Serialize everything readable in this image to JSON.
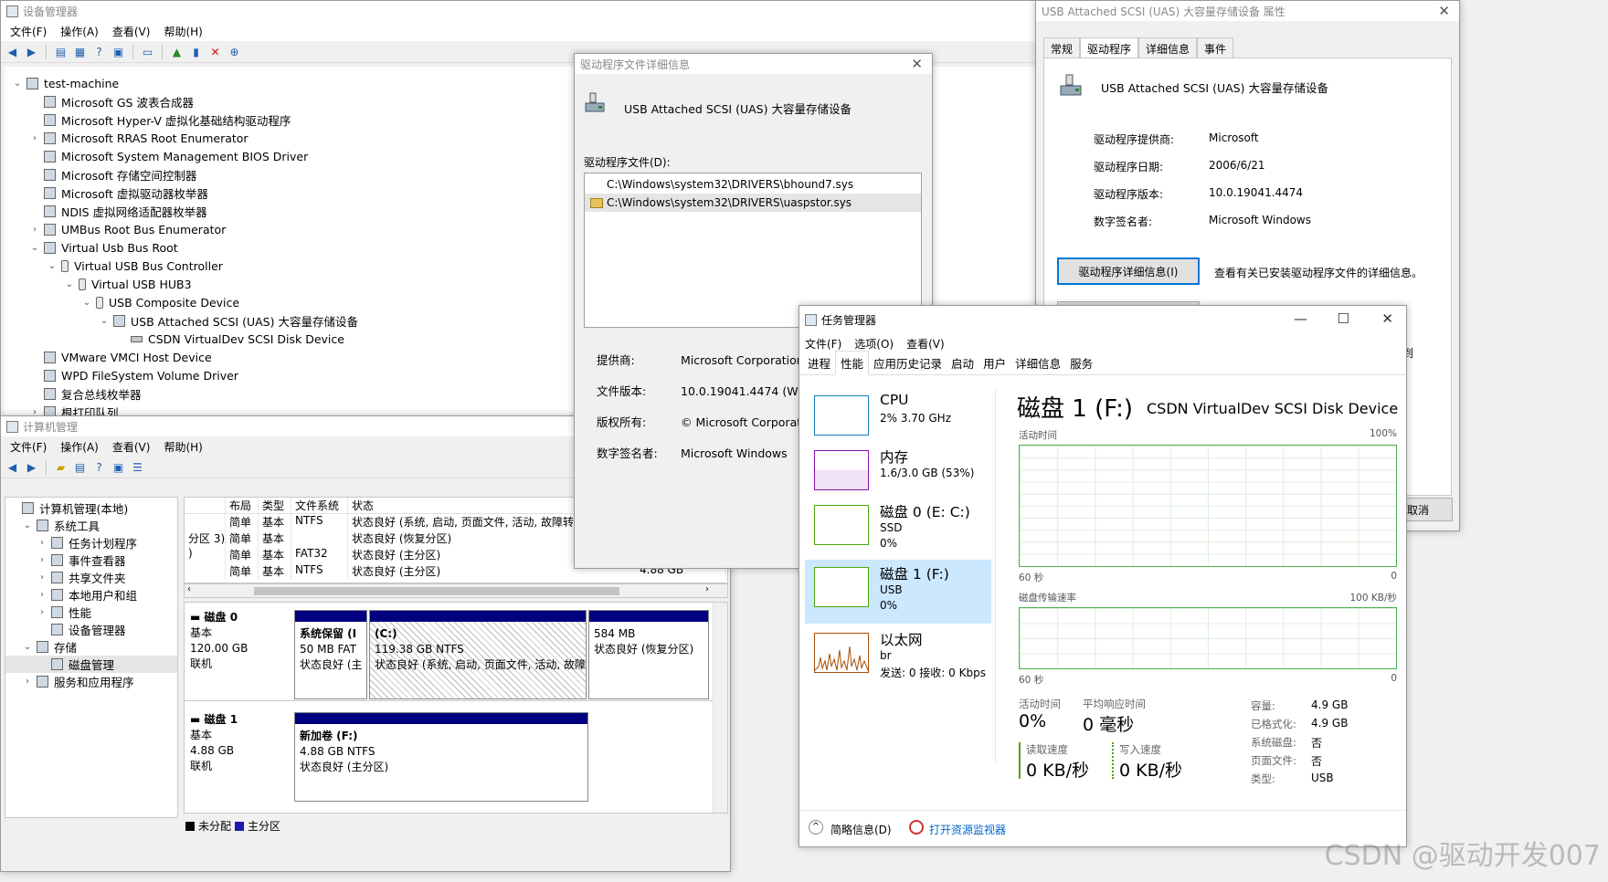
{
  "device_manager": {
    "title": "设备管理器",
    "menu": [
      "文件(F)",
      "操作(A)",
      "查看(V)",
      "帮助(H)"
    ],
    "tree": [
      {
        "label": "test-machine",
        "exp": "v",
        "level": 0
      },
      {
        "label": "Microsoft GS 波表合成器",
        "exp": "",
        "level": 1
      },
      {
        "label": "Microsoft Hyper-V 虚拟化基础结构驱动程序",
        "exp": "",
        "level": 1
      },
      {
        "label": "Microsoft RRAS Root Enumerator",
        "exp": ">",
        "level": 1
      },
      {
        "label": "Microsoft System Management BIOS Driver",
        "exp": "",
        "level": 1
      },
      {
        "label": "Microsoft 存储空间控制器",
        "exp": "",
        "level": 1
      },
      {
        "label": "Microsoft 虚拟驱动器枚举器",
        "exp": "",
        "level": 1
      },
      {
        "label": "NDIS 虚拟网络适配器枚举器",
        "exp": "",
        "level": 1
      },
      {
        "label": "UMBus Root Bus Enumerator",
        "exp": ">",
        "level": 1
      },
      {
        "label": "Virtual Usb Bus Root",
        "exp": "v",
        "level": 1
      },
      {
        "label": "Virtual USB Bus Controller",
        "exp": "v",
        "level": 2
      },
      {
        "label": "Virtual USB HUB3",
        "exp": "v",
        "level": 3
      },
      {
        "label": "USB Composite Device",
        "exp": "v",
        "level": 4
      },
      {
        "label": "USB Attached SCSI (UAS) 大容量存储设备",
        "exp": "v",
        "level": 5
      },
      {
        "label": "CSDN VirtualDev SCSI Disk Device",
        "exp": "",
        "level": 6
      },
      {
        "label": "VMware VMCI Host Device",
        "exp": "",
        "level": 1
      },
      {
        "label": "WPD FileSystem Volume Driver",
        "exp": "",
        "level": 1
      },
      {
        "label": "复合总线枚举器",
        "exp": "",
        "level": 1
      },
      {
        "label": "根打印队列",
        "exp": ">",
        "level": 1
      }
    ]
  },
  "computer_management": {
    "title": "计算机管理",
    "menu": [
      "文件(F)",
      "操作(A)",
      "查看(V)",
      "帮助(H)"
    ],
    "nav": [
      {
        "label": "计算机管理(本地)",
        "exp": "",
        "level": 0
      },
      {
        "label": "系统工具",
        "exp": "v",
        "level": 1
      },
      {
        "label": "任务计划程序",
        "exp": ">",
        "level": 2
      },
      {
        "label": "事件查看器",
        "exp": ">",
        "level": 2
      },
      {
        "label": "共享文件夹",
        "exp": ">",
        "level": 2
      },
      {
        "label": "本地用户和组",
        "exp": ">",
        "level": 2
      },
      {
        "label": "性能",
        "exp": ">",
        "level": 2
      },
      {
        "label": "设备管理器",
        "exp": "",
        "level": 2
      },
      {
        "label": "存储",
        "exp": "v",
        "level": 1
      },
      {
        "label": "磁盘管理",
        "exp": "",
        "level": 2
      },
      {
        "label": "服务和应用程序",
        "exp": ">",
        "level": 1
      }
    ],
    "columns": [
      "",
      "布局",
      "类型",
      "文件系统",
      "状态"
    ],
    "rows": [
      [
        "",
        "简单",
        "基本",
        "NTFS",
        "状态良好 (系统, 启动, 页面文件, 活动, 故障转储"
      ],
      [
        "分区 3)",
        "简单",
        "基本",
        "",
        "状态良好 (恢复分区)"
      ],
      [
        ")",
        "简单",
        "基本",
        "FAT32",
        "状态良好 (主分区)"
      ],
      [
        "",
        "简单",
        "基本",
        "NTFS",
        "状态良好 (主分区)"
      ]
    ],
    "disk0": {
      "name": "磁盘 0",
      "type": "基本",
      "size": "120.00 GB",
      "status": "联机",
      "parts": [
        {
          "name": "系统保留 (I",
          "size": "50 MB FAT",
          "status": "状态良好 (主"
        },
        {
          "name": "(C:)",
          "size": "119.38 GB NTFS",
          "status": "状态良好 (系统, 启动, 页面文件, 活动, 故障"
        },
        {
          "name": "",
          "size": "584 MB",
          "status": "状态良好 (恢复分区)"
        }
      ]
    },
    "disk1": {
      "name": "磁盘 1",
      "type": "基本",
      "size": "4.88 GB",
      "status": "联机",
      "parts": [
        {
          "name": "新加卷 (F:)",
          "size": "4.88 GB NTFS",
          "status": "状态良好 (主分区)"
        }
      ]
    },
    "legend": {
      "unallocated": "未分配",
      "primary": "主分区"
    }
  },
  "driver_details": {
    "title": "驱动程序文件详细信息",
    "device": "USB Attached SCSI (UAS) 大容量存储设备",
    "files_label": "驱动程序文件(D):",
    "files": [
      "C:\\Windows\\system32\\DRIVERS\\bhound7.sys",
      "C:\\Windows\\system32\\DRIVERS\\uaspstor.sys"
    ],
    "provider_k": "提供商:",
    "provider_v": "Microsoft Corporation",
    "version_k": "文件版本:",
    "version_v": "10.0.19041.4474 (WinB",
    "copyright_k": "版权所有:",
    "copyright_v": "© Microsoft Corporati",
    "signer_k": "数字签名者:",
    "signer_v": "Microsoft Windows"
  },
  "properties": {
    "title": "USB Attached SCSI (UAS) 大容量存储设备 属性",
    "tabs": [
      "常规",
      "驱动程序",
      "详细信息",
      "事件"
    ],
    "device": "USB Attached SCSI (UAS) 大容量存储设备",
    "provider_k": "驱动程序提供商:",
    "provider_v": "Microsoft",
    "date_k": "驱动程序日期:",
    "date_v": "2006/6/21",
    "version_k": "驱动程序版本:",
    "version_v": "10.0.19041.4474",
    "signer_k": "数字签名者:",
    "signer_v": "Microsoft Windows",
    "details_button": "驱动程序详细信息(I)",
    "details_desc": "查看有关已安装驱动程序文件的详细信息。",
    "partial_text": "退到",
    "cancel_partial": "取消"
  },
  "task_manager": {
    "title": "任务管理器",
    "menu": [
      "文件(F)",
      "选项(O)",
      "查看(V)"
    ],
    "tabs": [
      "进程",
      "性能",
      "应用历史记录",
      "启动",
      "用户",
      "详细信息",
      "服务"
    ],
    "side": [
      {
        "title": "CPU",
        "sub1": "2% 3.70 GHz",
        "sub2": ""
      },
      {
        "title": "内存",
        "sub1": "1.6/3.0 GB (53%)",
        "sub2": ""
      },
      {
        "title": "磁盘 0 (E: C:)",
        "sub1": "SSD",
        "sub2": "0%"
      },
      {
        "title": "磁盘 1 (F:)",
        "sub1": "USB",
        "sub2": "0%"
      },
      {
        "title": "以太网",
        "sub1": "br",
        "sub2": "发送: 0 接收: 0 Kbps"
      }
    ],
    "main_title": "磁盘 1 (F:)",
    "main_device": "CSDN VirtualDev SCSI Disk Device",
    "g1_label": "活动时间",
    "g1_max": "100%",
    "g1_left": "60 秒",
    "g1_right": "0",
    "g2_label": "磁盘传输速率",
    "g2_max": "100 KB/秒",
    "g2_left": "60 秒",
    "g2_right": "0",
    "active_k": "活动时间",
    "active_v": "0%",
    "resp_k": "平均响应时间",
    "resp_v": "0 毫秒",
    "read_k": "读取速度",
    "read_v": "0 KB/秒",
    "write_k": "写入速度",
    "write_v": "0 KB/秒",
    "details": [
      {
        "k": "容量:",
        "v": "4.9 GB"
      },
      {
        "k": "已格式化:",
        "v": "4.9 GB"
      },
      {
        "k": "系统磁盘:",
        "v": "否"
      },
      {
        "k": "页面文件:",
        "v": "否"
      },
      {
        "k": "类型:",
        "v": "USB"
      }
    ],
    "footer_brief": "简略信息(D)",
    "footer_monitor": "打开资源监视器"
  },
  "watermark": "CSDN @驱动开发007"
}
